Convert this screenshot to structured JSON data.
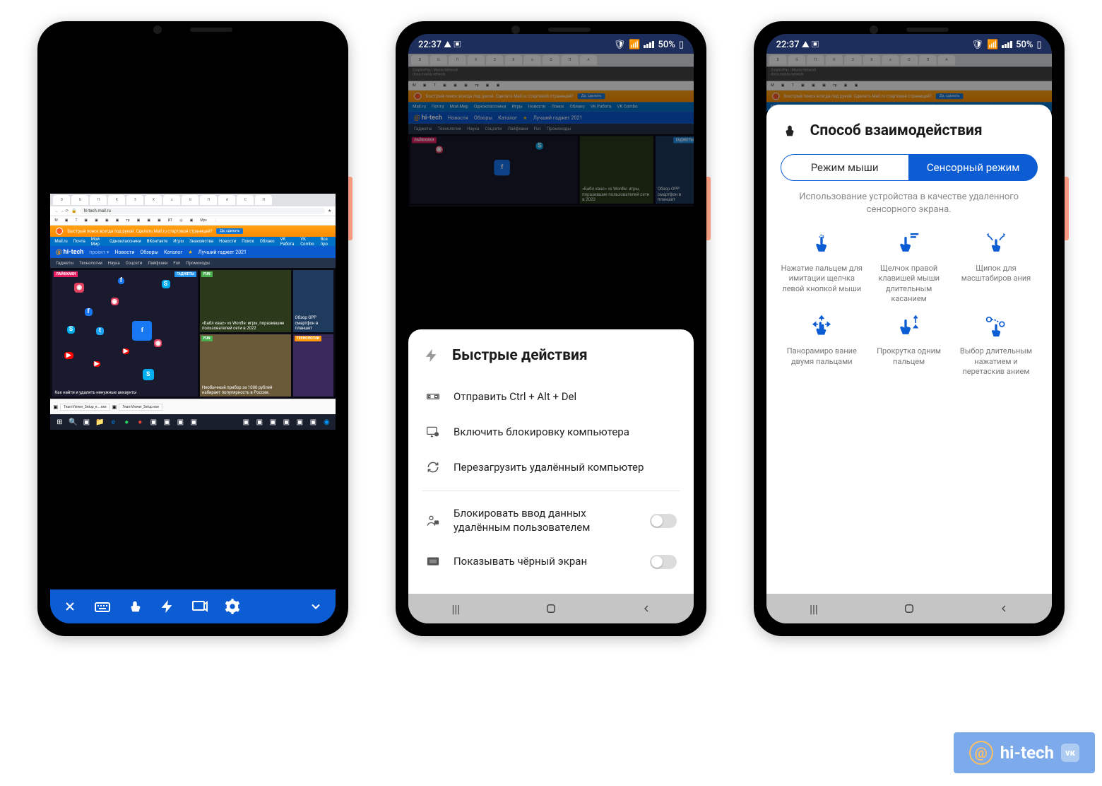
{
  "status": {
    "time": "22:37",
    "battery": "50%"
  },
  "phone1": {
    "address_url": "hi-tech.mail.ru",
    "yellow_banner": "Быстрый поиск всегда под рукой. Сделать Mail.ru стартовой страницей?",
    "yellow_banner_btn": "Да, сделать",
    "mail_nav": [
      "Mail.ru",
      "Почта",
      "Мой Мир",
      "Одноклассники",
      "ВКонтакте",
      "Игры",
      "Знакомства",
      "Новости",
      "Поиск",
      "Облако",
      "VK Работа",
      "VK Combo",
      "Все про"
    ],
    "hitech_logo": "hi-tech",
    "hitech_nav": [
      "Новости",
      "Обзоры",
      "Каталог"
    ],
    "hitech_award": "Лучший гаджет 2021",
    "hitech_sub": [
      "Гаджеты",
      "Технологии",
      "Наука",
      "Соцсети",
      "Лайфхаки",
      "Fun",
      "Промокоды"
    ],
    "tag_lifehack": "ЛАЙФХАКИ",
    "tag_gadgets": "ГАДЖЕТЫ",
    "tag_fun": "FUN",
    "tag_tech": "ТЕХНОЛОГИИ",
    "article1": "Как найти и удалить ненужные аккаунты",
    "article2": "«Бабл квас» vs Wordle: игры, поразившие пользователей сети в 2022",
    "article3": "Обзор OPP смартфон в планшет",
    "article4": "Необычный прибор за 1000 рублей набирает популярность в России.",
    "taskbar_file1": "TeamViewer_Setup_e....exe",
    "taskbar_file2": "TeamViewer_Setup.exe"
  },
  "phone2": {
    "title": "Быстрые действия",
    "action1": "Отправить Ctrl + Alt + Del",
    "action2": "Включить блокировку компьютера",
    "action3": "Перезагрузить удалённый компьютер",
    "toggle1": "Блокировать ввод данных удалённым пользователем",
    "toggle2": "Показывать чёрный экран"
  },
  "phone3": {
    "title": "Способ взаимодействия",
    "mode_mouse": "Режим мыши",
    "mode_touch": "Сенсорный режим",
    "description": "Использование устройства в качестве удаленного сенсорного экрана.",
    "gestures": [
      "Нажатие пальцем для имитации щелчка левой кнопкой мыши",
      "Щелчок правой клавишей мыши длительным касанием",
      "Щипок для масштабиров ания",
      "Панорамиро вание двумя пальцами",
      "Прокрутка одним пальцем",
      "Выбор длительным нажатием и перетаскив анием"
    ]
  },
  "watermark": "hi-tech"
}
